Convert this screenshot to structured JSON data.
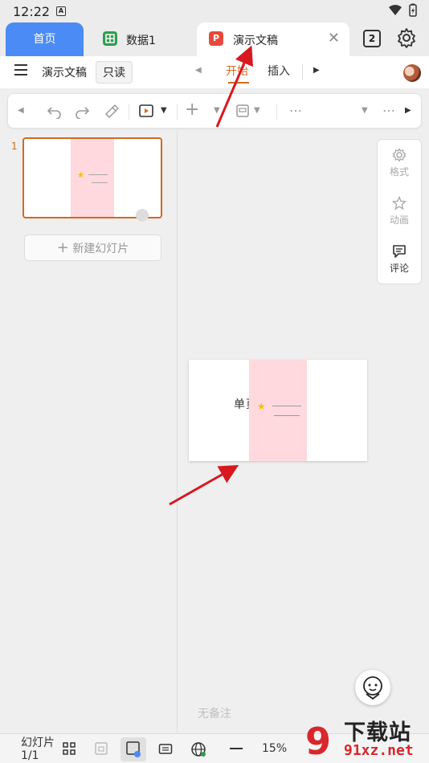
{
  "status_bar": {
    "time": "12:22",
    "notif_icon_letter": "A"
  },
  "tabs": [
    {
      "label": "首页",
      "active": false
    },
    {
      "label": "数据1",
      "icon": "sheet-icon",
      "icon_color": "#2e9e4f"
    },
    {
      "label": "演示文稿",
      "icon": "ppt-icon",
      "icon_color": "#e64a3c",
      "active": true
    }
  ],
  "tab_count": "2",
  "header": {
    "doc_title": "演示文稿",
    "readonly": "只读",
    "menu_tabs": [
      "开始",
      "插入"
    ],
    "accent": "#d2691e"
  },
  "left_pane": {
    "slide_number": "1",
    "new_slide": "新建幻灯片"
  },
  "side_panel": {
    "items": [
      "格式",
      "动画",
      "评论"
    ]
  },
  "slide": {
    "title": "单页标题"
  },
  "notes_placeholder": "无备注",
  "bottom_bar": {
    "slide_counter": "幻灯片 1/1",
    "zoom": "15%"
  },
  "watermark": {
    "text": "下载站",
    "url": "91xz.net",
    "logo": "9"
  }
}
